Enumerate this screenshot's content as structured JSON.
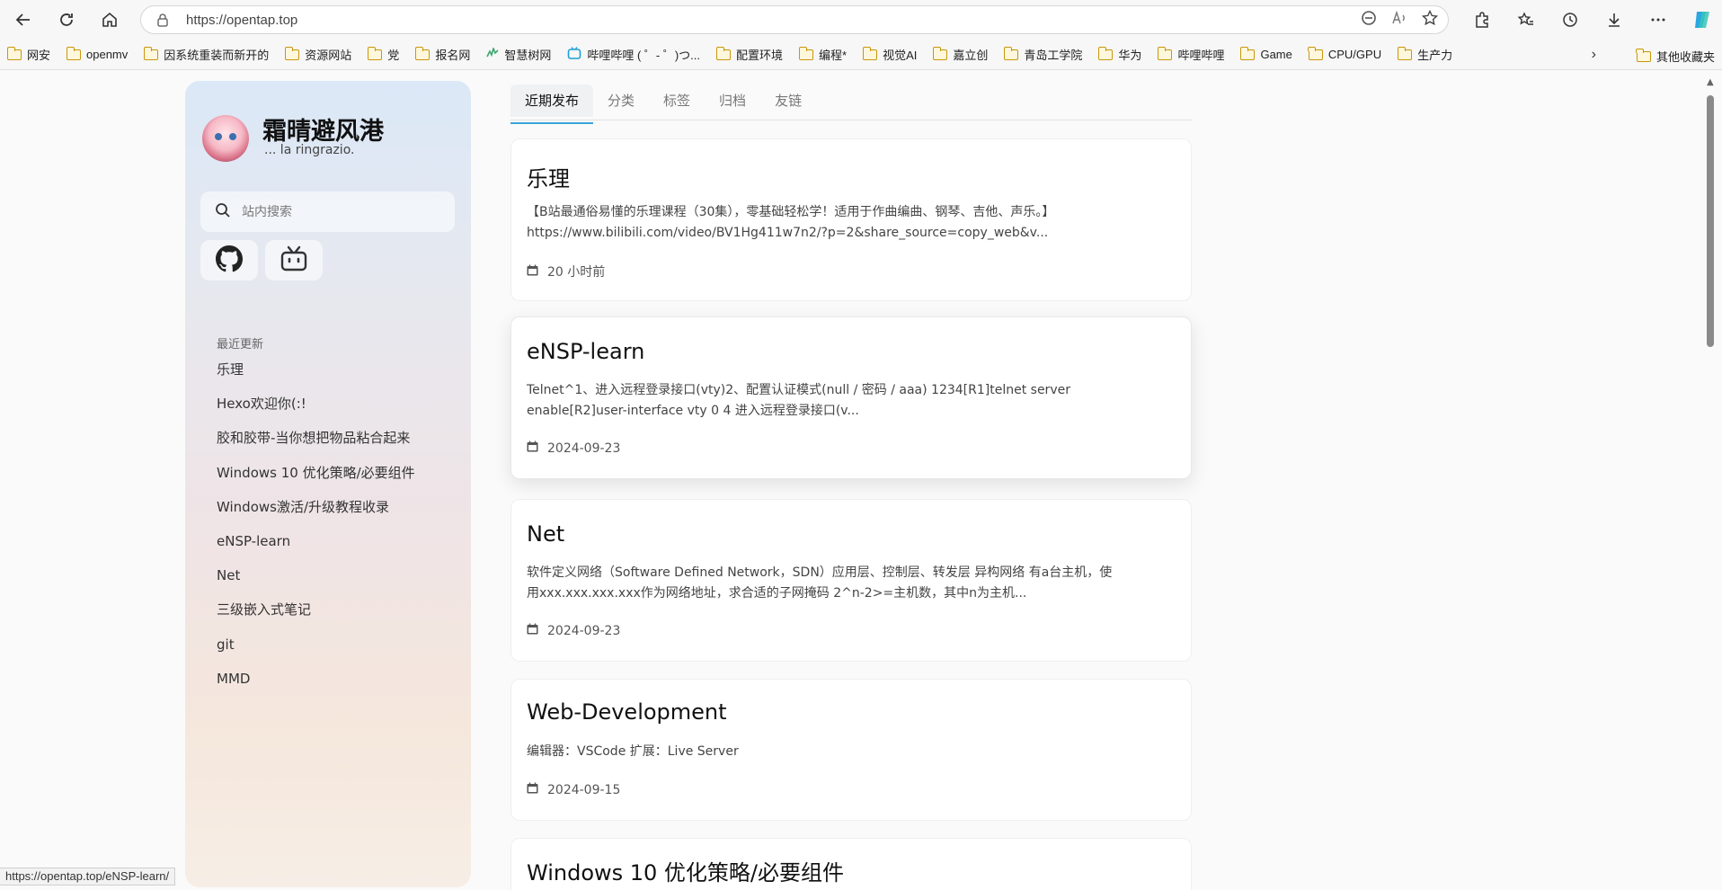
{
  "browser": {
    "url": "https://opentap.top",
    "status_url": "https://opentap.top/eNSP-learn/",
    "bookmarks": [
      {
        "label": "网安",
        "icon": "folder-icon"
      },
      {
        "label": "openmv",
        "icon": "folder-icon"
      },
      {
        "label": "因系统重装而新开的",
        "icon": "folder-icon"
      },
      {
        "label": "资源网站",
        "icon": "folder-icon"
      },
      {
        "label": "党",
        "icon": "folder-icon"
      },
      {
        "label": "报名网",
        "icon": "folder-icon"
      },
      {
        "label": "智慧树网",
        "icon": "site-icon"
      },
      {
        "label": "哔哩哔哩 ( ゜- ゜)つ...",
        "icon": "bilibili-icon"
      },
      {
        "label": "配置环境",
        "icon": "folder-icon"
      },
      {
        "label": "编程*",
        "icon": "folder-icon"
      },
      {
        "label": "视觉AI",
        "icon": "folder-icon"
      },
      {
        "label": "嘉立创",
        "icon": "folder-icon"
      },
      {
        "label": "青岛工学院",
        "icon": "folder-icon"
      },
      {
        "label": "华为",
        "icon": "folder-icon"
      },
      {
        "label": "哔哩哔哩",
        "icon": "folder-icon"
      },
      {
        "label": "Game",
        "icon": "folder-icon"
      },
      {
        "label": "CPU/GPU",
        "icon": "folder-icon"
      },
      {
        "label": "生产力",
        "icon": "folder-icon"
      }
    ],
    "other_bookmarks": "其他收藏夹"
  },
  "sidebar": {
    "title": "霜晴避风港",
    "subtitle": "... la ringrazio.",
    "search_placeholder": "站内搜索",
    "recent_title": "最近更新",
    "recent": [
      "乐理",
      "Hexo欢迎你(:!",
      "胶和胶带-当你想把物品粘合起来",
      "Windows 10 优化策略/必要组件",
      "Windows激活/升级教程收录",
      "eNSP-learn",
      "Net",
      "三级嵌入式笔记",
      "git",
      "MMD"
    ]
  },
  "tabs": [
    "近期发布",
    "分类",
    "标签",
    "归档",
    "友链"
  ],
  "posts": [
    {
      "title": "乐理",
      "desc1": "【B站最通俗易懂的乐理课程（30集），零基础轻松学！适用于作曲编曲、钢琴、吉他、声乐。】",
      "desc2": "https://www.bilibili.com/video/BV1Hg411w7n2/?p=2&share_source=copy_web&v...",
      "date": "20 小时前"
    },
    {
      "title": "eNSP-learn",
      "desc1": "Telnet^1、进入远程登录接口(vty)2、配置认证模式(null / 密码 / aaa) 1234[R1]telnet server",
      "desc2": "enable[R2]user-interface vty 0 4 进入远程登录接口(v...",
      "date": "2024-09-23"
    },
    {
      "title": "Net",
      "desc1": "软件定义网络（Software Defined Network，SDN）应用层、控制层、转发层 异构网络 有a台主机，使",
      "desc2": "用xxx.xxx.xxx.xxx作为网络地址，求合适的子网掩码 2^n-2>=主机数，其中n为主机...",
      "date": "2024-09-23"
    },
    {
      "title": "Web-Development",
      "desc1": "编辑器：VSCode 扩展：Live Server",
      "desc2": "",
      "date": "2024-09-15"
    },
    {
      "title": "Windows 10 优化策略/必要组件",
      "desc1": "",
      "desc2": "",
      "date": ""
    }
  ]
}
